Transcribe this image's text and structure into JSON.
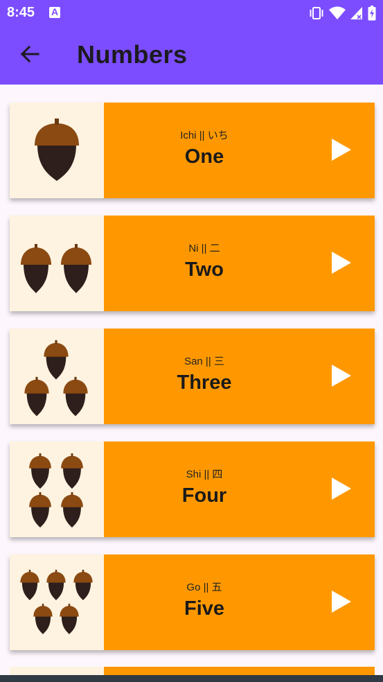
{
  "status_bar": {
    "time": "8:45",
    "notification_icon": "a-icon",
    "icons": [
      "vibrate-icon",
      "wifi-icon",
      "cell-signal-icon",
      "battery-charging-icon"
    ]
  },
  "app_bar": {
    "back_icon": "arrow-back-icon",
    "title": "Numbers"
  },
  "colors": {
    "app_bar": "#7b4dff",
    "card_panel": "#ff9800",
    "thumb_bg": "#fef3e0",
    "acorn_cap": "#8b4a12",
    "acorn_body": "#2e1f1c"
  },
  "items": [
    {
      "japanese": "Ichi || いち",
      "english": "One",
      "acorn_count": 1
    },
    {
      "japanese": "Ni || 二",
      "english": "Two",
      "acorn_count": 2
    },
    {
      "japanese": "San || 三",
      "english": "Three",
      "acorn_count": 3
    },
    {
      "japanese": "Shi || 四",
      "english": "Four",
      "acorn_count": 4
    },
    {
      "japanese": "Go || 五",
      "english": "Five",
      "acorn_count": 5
    }
  ]
}
